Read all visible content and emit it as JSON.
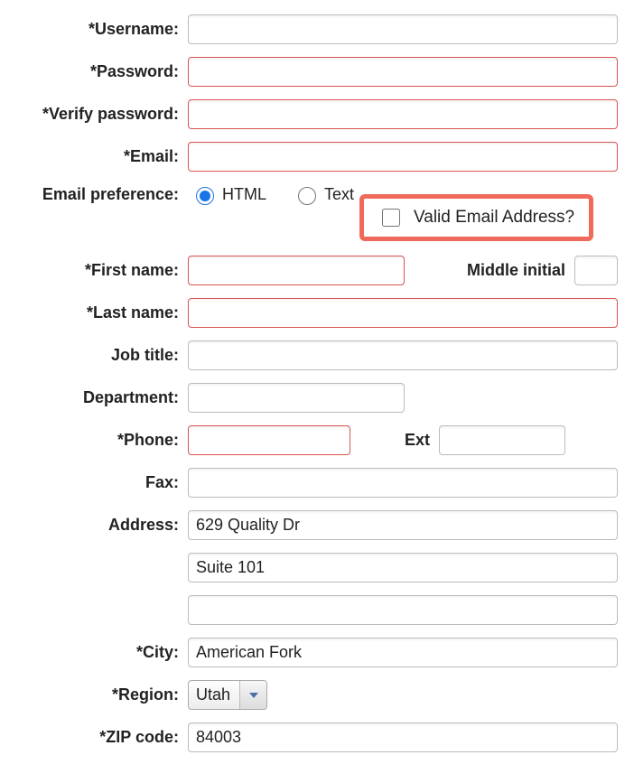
{
  "labels": {
    "username": "*Username:",
    "password": "*Password:",
    "verify_password": "*Verify password:",
    "email": "*Email:",
    "email_pref": "Email preference:",
    "valid_email": "Valid Email Address?",
    "first_name": "*First name:",
    "middle_initial": "Middle initial",
    "last_name": "*Last name:",
    "job_title": "Job title:",
    "department": "Department:",
    "phone": "*Phone:",
    "ext": "Ext",
    "fax": "Fax:",
    "address": "Address:",
    "city": "*City:",
    "region": "*Region:",
    "zip": "*ZIP code:"
  },
  "email_pref_options": {
    "html": "HTML",
    "text": "Text"
  },
  "values": {
    "username": "",
    "password": "",
    "verify_password": "",
    "email": "",
    "first_name": "",
    "middle_initial": "",
    "last_name": "",
    "job_title": "",
    "department": "",
    "phone": "",
    "ext": "",
    "fax": "",
    "address1": "629 Quality Dr",
    "address2": "Suite 101",
    "address3": "",
    "city": "American Fork",
    "region": "Utah",
    "zip": "84003"
  }
}
